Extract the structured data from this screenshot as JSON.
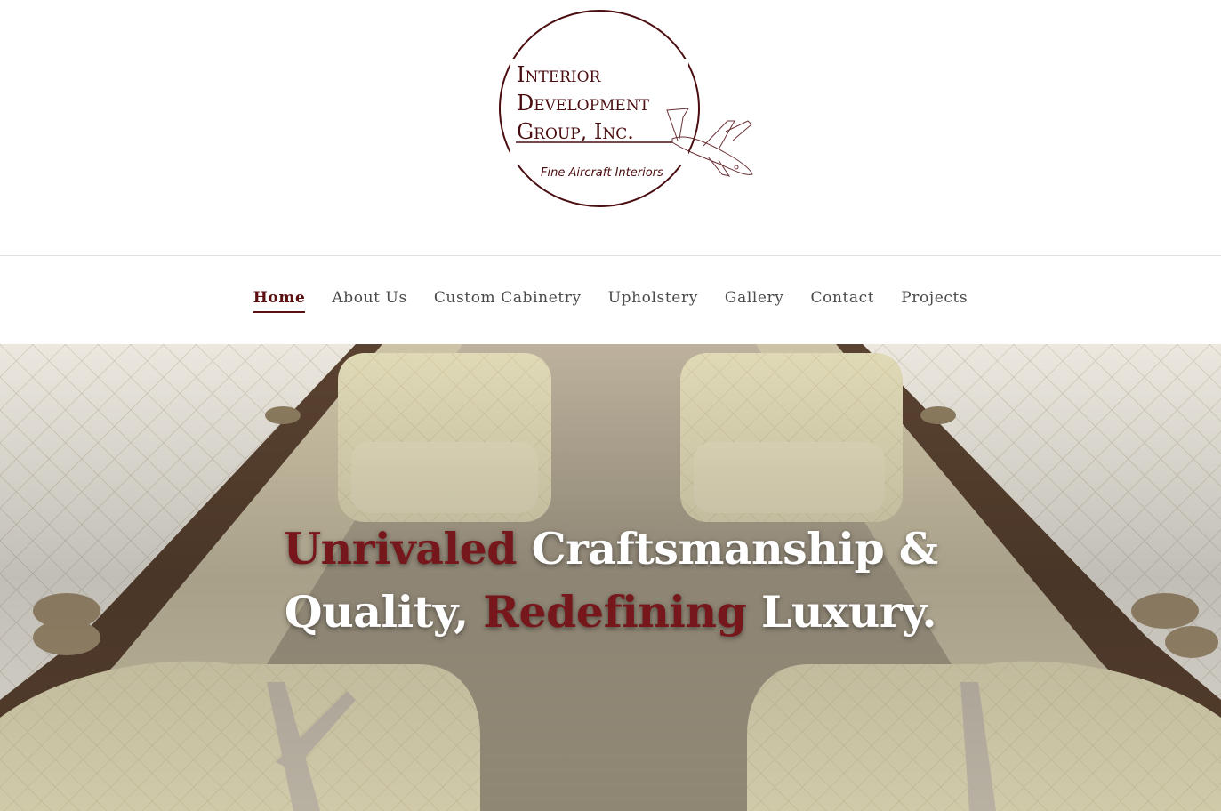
{
  "logo": {
    "line1": "Interior",
    "line2": "Development",
    "line3": "Group, Inc.",
    "tagline": "Fine Aircraft Interiors",
    "icon": "airplane-icon"
  },
  "nav": {
    "items": [
      {
        "label": "Home",
        "active": true
      },
      {
        "label": "About Us"
      },
      {
        "label": "Custom Cabinetry"
      },
      {
        "label": "Upholstery"
      },
      {
        "label": "Gallery"
      },
      {
        "label": "Contact"
      },
      {
        "label": "Projects"
      }
    ]
  },
  "hero": {
    "line1": {
      "accent": "Unrivaled",
      "rest": " Craftsmanship &"
    },
    "line2": {
      "lead": "Quality, ",
      "accent": "Redefining",
      "rest": " Luxury."
    },
    "image": "aircraft-cabin-interior"
  },
  "colors": {
    "accent": "#76181b",
    "nav_text": "#4a4a4a",
    "hero_text": "#ffffff"
  }
}
